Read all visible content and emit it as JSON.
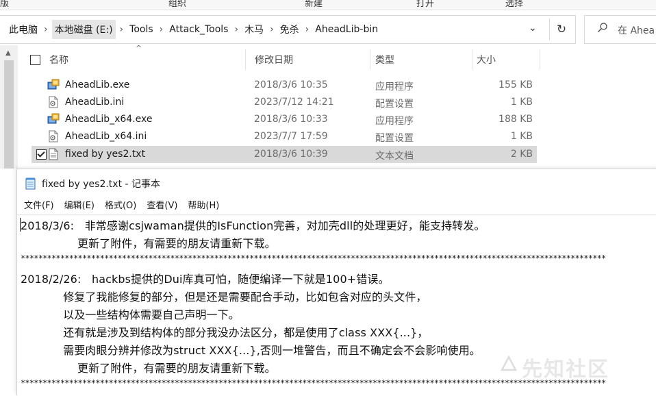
{
  "ribbon": {
    "labels": [
      "版",
      "组织",
      "新建",
      "打开",
      "选择"
    ]
  },
  "address": {
    "crumbs": [
      "此电脑",
      "本地磁盘 (E:)",
      "Tools",
      "Attack_Tools",
      "木马",
      "免杀",
      "AheadLib-bin"
    ],
    "search_placeholder": "在 Ahea"
  },
  "columns": {
    "name": "名称",
    "date": "修改日期",
    "type": "类型",
    "size": "大小"
  },
  "files": [
    {
      "name": "AheadLib.exe",
      "date": "2018/3/6 10:35",
      "type": "应用程序",
      "size": "155 KB",
      "icon": "exe-icon",
      "selected": false
    },
    {
      "name": "AheadLib.ini",
      "date": "2023/7/12 14:21",
      "type": "配置设置",
      "size": "1 KB",
      "icon": "ini-icon",
      "selected": false
    },
    {
      "name": "AheadLib_x64.exe",
      "date": "2018/3/6 10:33",
      "type": "应用程序",
      "size": "188 KB",
      "icon": "exe-icon",
      "selected": false
    },
    {
      "name": "AheadLib_x64.ini",
      "date": "2023/7/7 17:59",
      "type": "配置设置",
      "size": "1 KB",
      "icon": "ini-icon",
      "selected": false
    },
    {
      "name": "fixed by yes2.txt",
      "date": "2018/3/6 10:39",
      "type": "文本文档",
      "size": "2 KB",
      "icon": "txt-icon",
      "selected": true
    }
  ],
  "notepad": {
    "title": "fixed by yes2.txt - 记事本",
    "menu": [
      "文件(F)",
      "编辑(E)",
      "格式(O)",
      "查看(V)",
      "帮助(H)"
    ],
    "lines": [
      "2018/3/6:   非常感谢csjwaman提供的IsFunction完善，对加壳dll的处理更好，能支持转发。",
      "                更新了附件，有需要的朋友请重新下载。",
      "*************************************************************************************************************************************",
      "2018/2/26:   hackbs提供的Dui库真可怕，随便编译一下就是100+错误。",
      "            修复了我能修复的部分，但是还是需要配合手动，比如包含对应的头文件，",
      "            以及一些结构体需要自己声明一下。",
      "            还有就是涉及到结构体的部分我没办法区分，都是使用了class XXX{...}，",
      "            需要肉眼分辨并修改为struct XXX{...},否则一堆警告，而且不确定会不会影响使用。",
      "                更新了附件，有需要的朋友请重新下载。",
      "*************************************************************************************************************************************"
    ]
  },
  "watermark": "先知社区"
}
